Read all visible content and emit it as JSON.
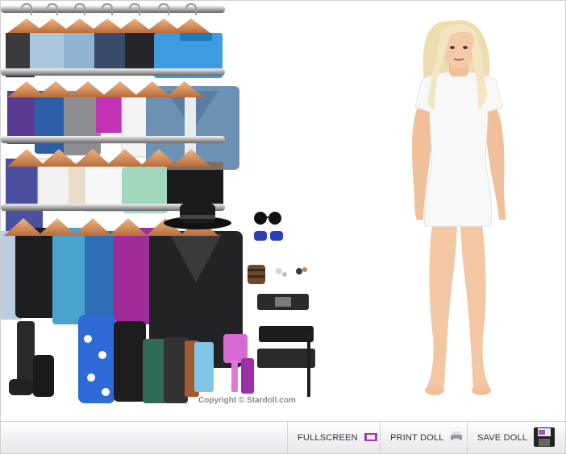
{
  "app": {
    "copyright": "Copyright © Stardoll.com"
  },
  "toolbar": {
    "fullscreen_label": "FULLSCREEN",
    "print_label": "PRINT DOLL",
    "save_label": "SAVE DOLL"
  },
  "colors": {
    "background": "#ffffff",
    "toolbar": "#f1eef3",
    "doll_dress": "#f8f8f8",
    "skin": "#f3c9a6",
    "hair": "#f2e6c2",
    "accent": "#9b3fb0"
  },
  "icons": [
    "fullscreen-icon",
    "printer-icon",
    "floppy-disk-icon"
  ]
}
